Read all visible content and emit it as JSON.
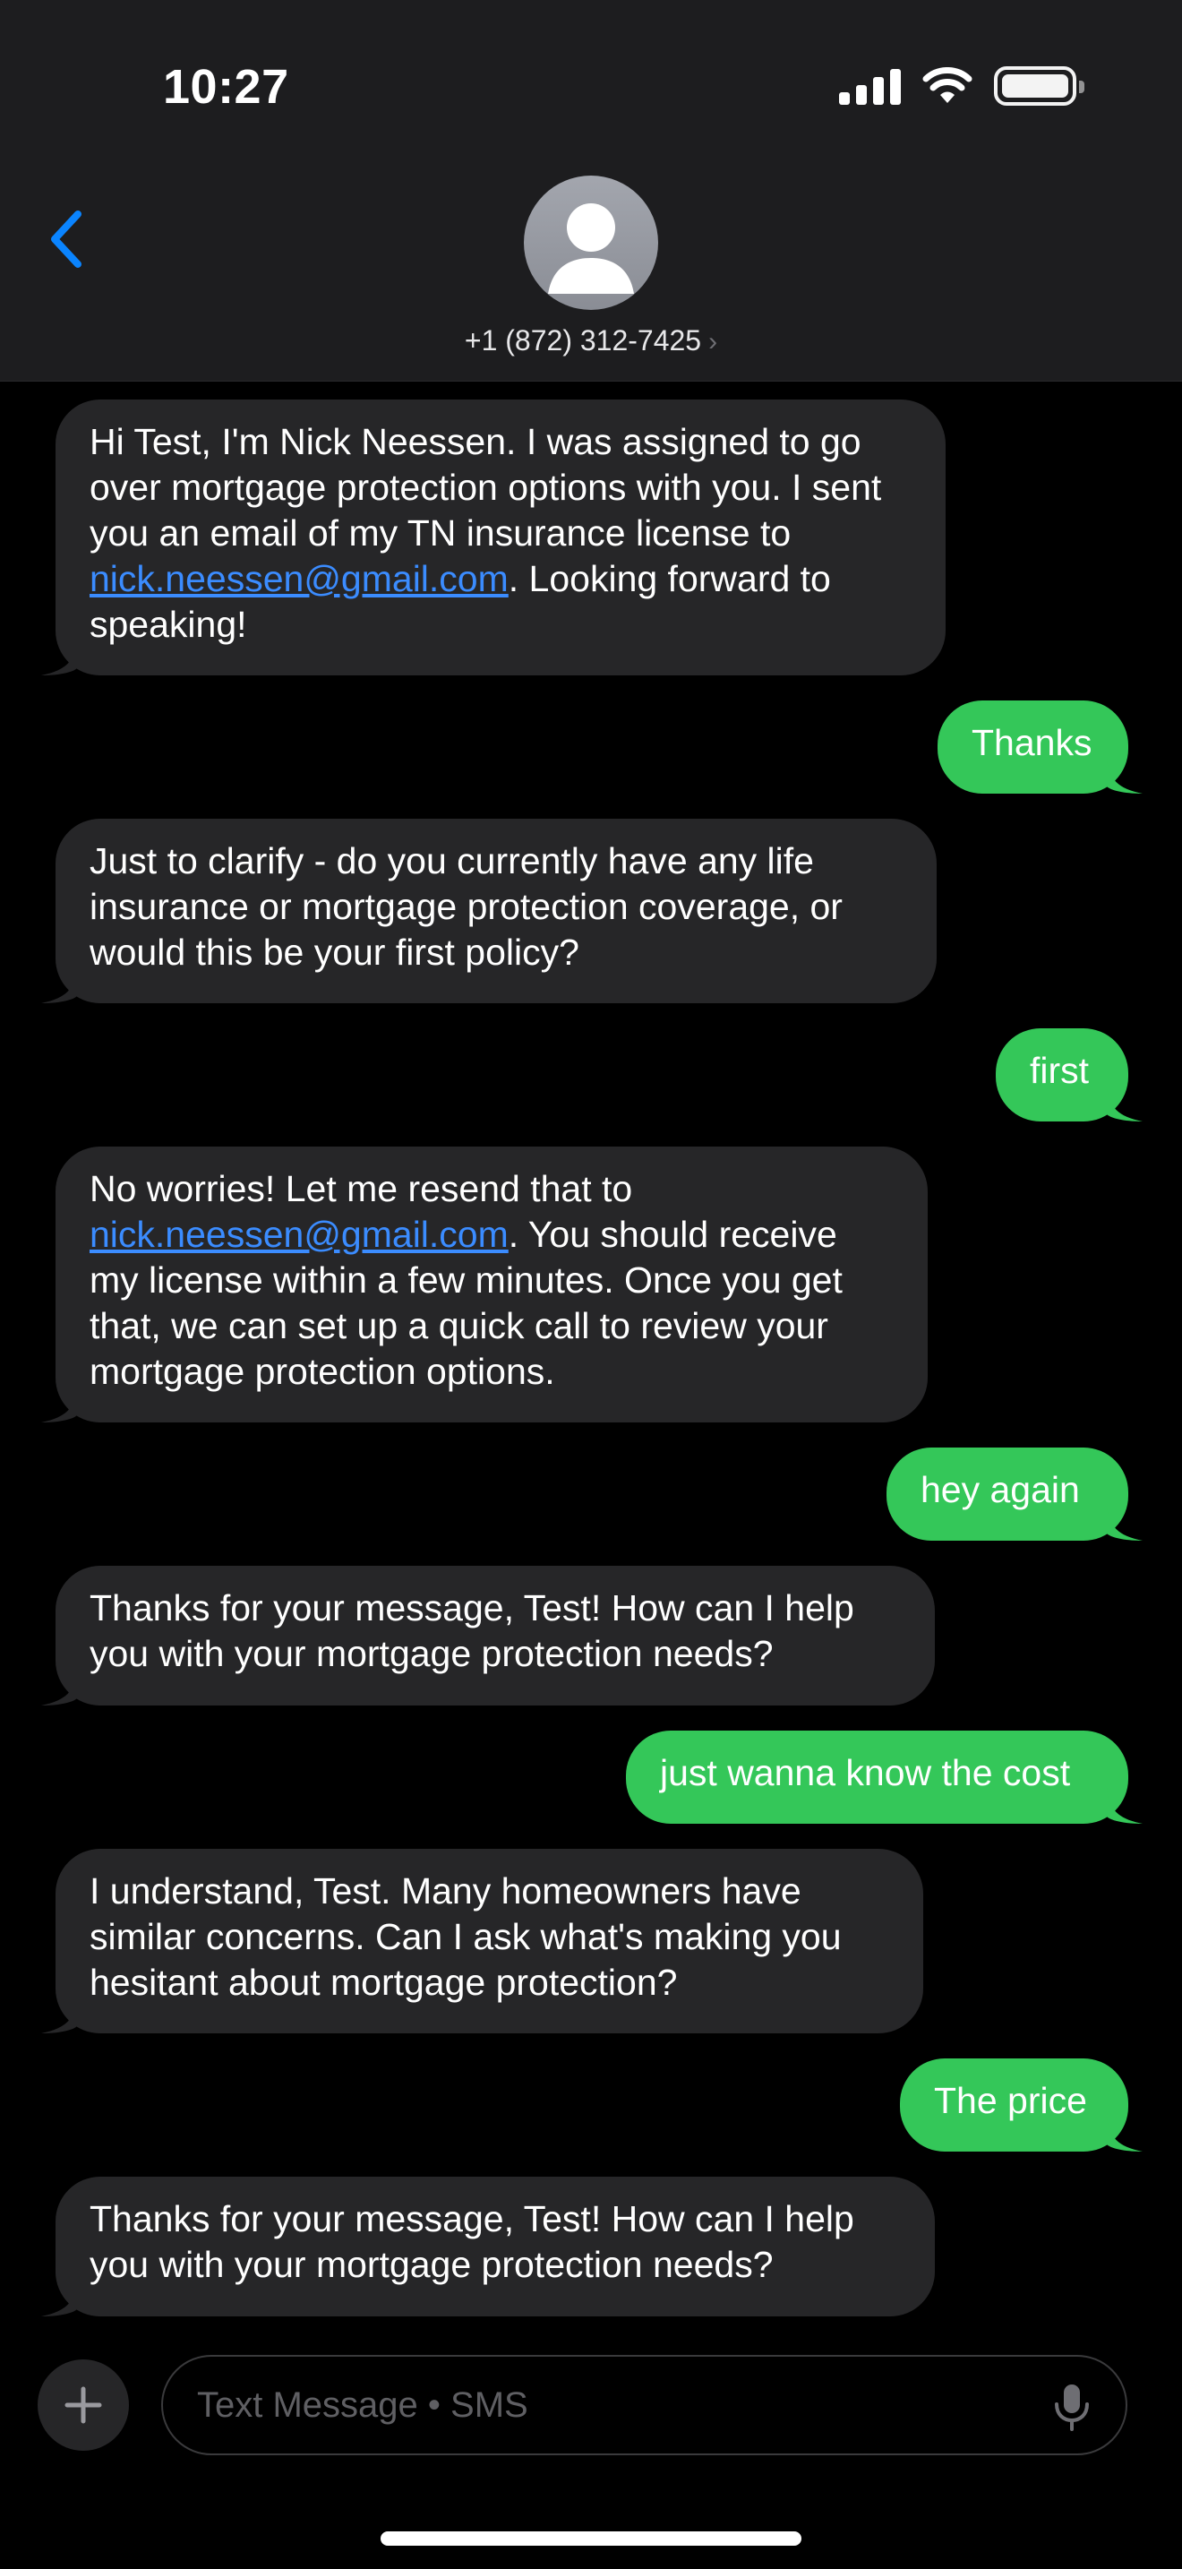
{
  "status_bar": {
    "time": "10:27"
  },
  "header": {
    "contact_number": "+1 (872) 312-7425",
    "chevron": "›"
  },
  "messages": [
    {
      "direction": "in",
      "parts": [
        "Hi Test, I'm Nick Neessen. I was assigned to go over mortgage protection options with you. I sent you an email of my TN insurance license to ",
        "nick.neessen@gmail.com",
        ". Looking forward to speaking!"
      ]
    },
    {
      "direction": "out",
      "text": "Thanks"
    },
    {
      "direction": "in",
      "text": "Just to clarify - do you currently have any life insurance or mortgage protection coverage, or would this be your first policy?"
    },
    {
      "direction": "out",
      "text": "first"
    },
    {
      "direction": "in",
      "parts": [
        "No worries! Let me resend that to ",
        "nick.neessen@gmail.com",
        ". You should receive my license within a few minutes. Once you get that, we can set up a quick call to review your mortgage protection options."
      ]
    },
    {
      "direction": "out",
      "text": "hey again"
    },
    {
      "direction": "in",
      "text": "Thanks for your message, Test! How can I help you with your mortgage protection needs?"
    },
    {
      "direction": "out",
      "text": "just wanna know the cost"
    },
    {
      "direction": "in",
      "text": "I understand, Test. Many homeowners have similar concerns. Can I ask what's making you hesitant about mortgage protection?"
    },
    {
      "direction": "out",
      "text": "The price"
    },
    {
      "direction": "in",
      "text": "Thanks for your message, Test! How can I help you with your mortgage protection needs?"
    }
  ],
  "compose": {
    "placeholder": "Text Message • SMS"
  },
  "colors": {
    "incoming_bubble": "#262628",
    "outgoing_bubble": "#34c759",
    "link": "#3b8cff",
    "accent": "#0a84ff"
  },
  "icons": [
    "back-chevron-icon",
    "cellular-signal-icon",
    "wifi-icon",
    "battery-icon",
    "contact-avatar-icon",
    "plus-icon",
    "microphone-icon"
  ]
}
